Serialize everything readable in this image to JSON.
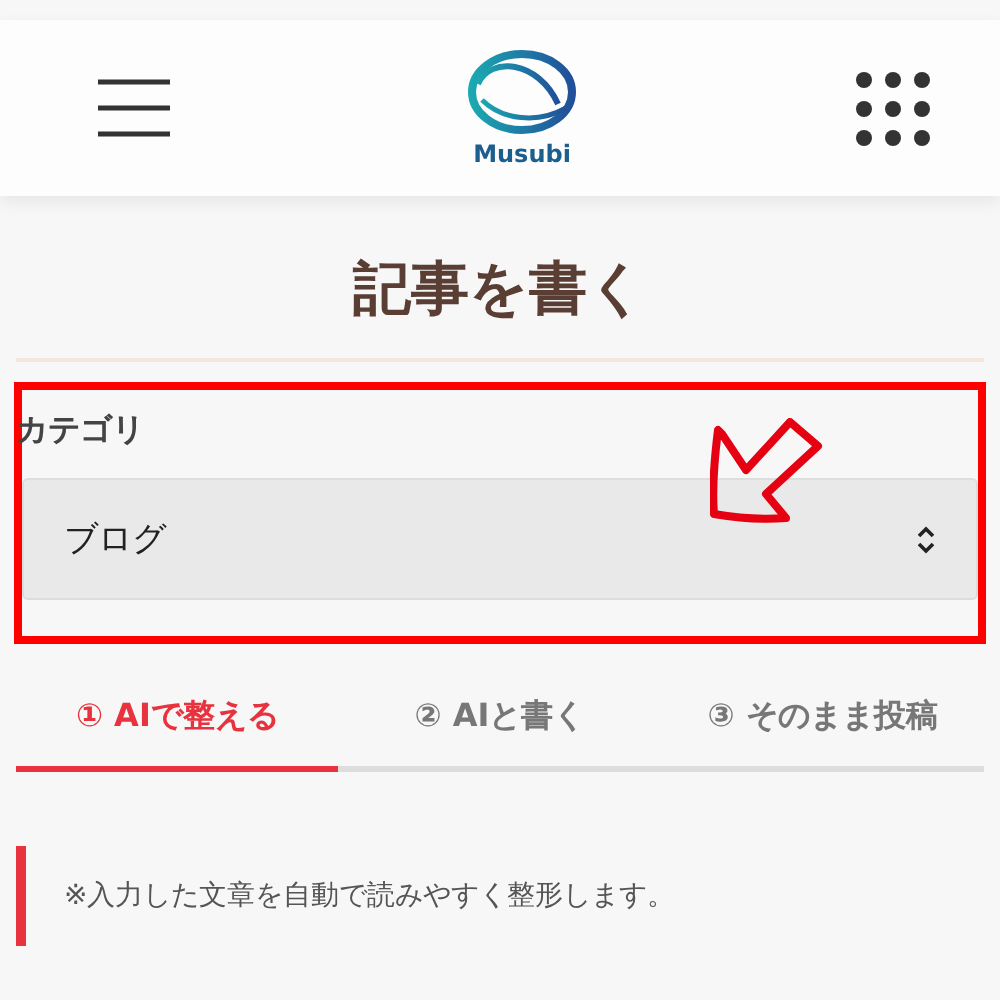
{
  "header": {
    "logo_text": "Musubi"
  },
  "page_title": "記事を書く",
  "category": {
    "label": "カテゴリ",
    "value": "ブログ"
  },
  "tabs": [
    {
      "label": "① AIで整える",
      "selected": true
    },
    {
      "label": "② AIと書く",
      "selected": false
    },
    {
      "label": "③ そのまま投稿",
      "selected": false
    }
  ],
  "note": "※入力した文章を自動で読みやすく整形します。"
}
